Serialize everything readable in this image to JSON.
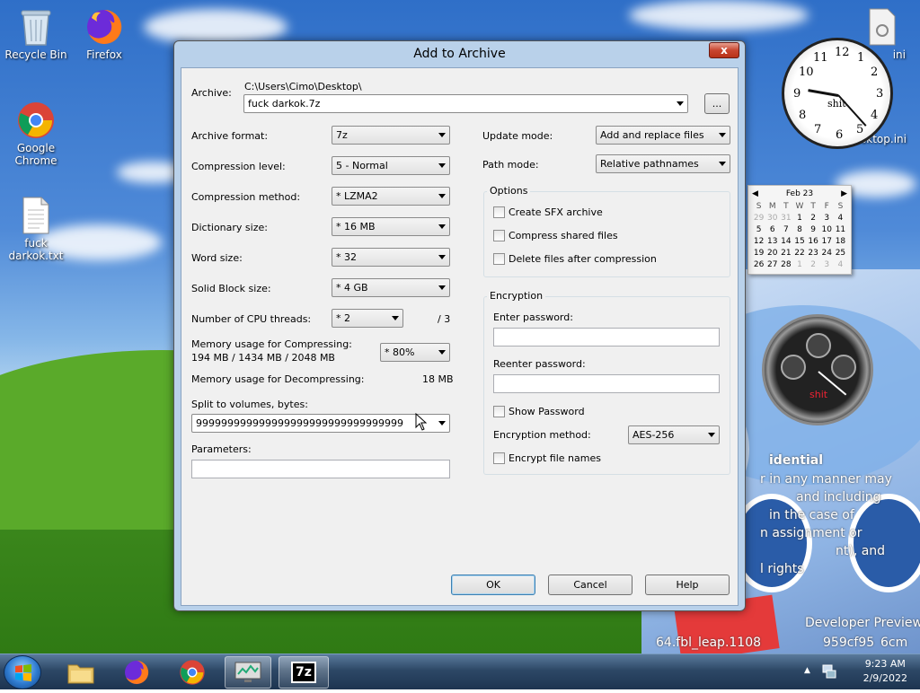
{
  "desktop": {
    "icons": [
      {
        "label": "Recycle Bin"
      },
      {
        "label": "Firefox"
      },
      {
        "label": "Google Chrome"
      },
      {
        "label": "fuck darkok.txt"
      }
    ],
    "right_icons": [
      {
        "label": "desktop.ini"
      },
      {
        "label": "ini"
      }
    ],
    "clock_gadget": {
      "brand": "shit",
      "numbers": [
        "12",
        "1",
        "2",
        "3",
        "4",
        "5",
        "6",
        "7",
        "8",
        "9",
        "10",
        "11"
      ]
    },
    "stopwatch_gadget": {
      "brand": "shit"
    },
    "calendar": {
      "month": "Feb 23",
      "weekdays": [
        "S",
        "M",
        "T",
        "W",
        "T",
        "F",
        "S"
      ],
      "weeks": [
        [
          "29",
          "30",
          "31",
          "1",
          "2",
          "3",
          "4"
        ],
        [
          "5",
          "6",
          "7",
          "8",
          "9",
          "10",
          "11"
        ],
        [
          "12",
          "13",
          "14",
          "15",
          "16",
          "17",
          "18"
        ],
        [
          "19",
          "20",
          "21",
          "22",
          "23",
          "24",
          "25"
        ],
        [
          "26",
          "27",
          "28",
          "1",
          "2",
          "3",
          "4"
        ]
      ]
    },
    "overlay_text": [
      "idential",
      "r in any manner may",
      "and including",
      "in the case of",
      "n assignment or",
      "nt), and",
      "l rights",
      "Developer Preview",
      "64.fbl_leap.1108",
      "959cf95",
      "6cm"
    ]
  },
  "dialog": {
    "title": "Add to Archive",
    "close_label": "x",
    "archive_label": "Archive:",
    "archive_path": "C:\\Users\\Cimo\\Desktop\\",
    "archive_name": "fuck darkok.7z",
    "browse_label": "...",
    "archive_format_label": "Archive format:",
    "archive_format": "7z",
    "compression_level_label": "Compression level:",
    "compression_level": "5 - Normal",
    "compression_method_label": "Compression method:",
    "compression_method": "* LZMA2",
    "dictionary_size_label": "Dictionary size:",
    "dictionary_size": "* 16 MB",
    "word_size_label": "Word size:",
    "word_size": "* 32",
    "solid_block_label": "Solid Block size:",
    "solid_block": "* 4 GB",
    "cpu_threads_label": "Number of CPU threads:",
    "cpu_threads": "* 2",
    "cpu_threads_max": "/ 3",
    "mem_compress_label": "Memory usage for Compressing:",
    "mem_compress_value": "194 MB / 1434 MB / 2048 MB",
    "mem_percent": "* 80%",
    "mem_decompress_label": "Memory usage for Decompressing:",
    "mem_decompress_value": "18 MB",
    "split_label": "Split to volumes, bytes:",
    "split_value": "999999999999999999999999999999999",
    "parameters_label": "Parameters:",
    "parameters_value": "",
    "update_mode_label": "Update mode:",
    "update_mode": "Add and replace files",
    "path_mode_label": "Path mode:",
    "path_mode": "Relative pathnames",
    "options_title": "Options",
    "opt_sfx": "Create SFX archive",
    "opt_shared": "Compress shared files",
    "opt_delete": "Delete files after compression",
    "encryption_title": "Encryption",
    "enter_password_label": "Enter password:",
    "reenter_password_label": "Reenter password:",
    "show_password": "Show Password",
    "encryption_method_label": "Encryption method:",
    "encryption_method": "AES-256",
    "encrypt_names": "Encrypt file names",
    "ok_label": "OK",
    "cancel_label": "Cancel",
    "help_label": "Help"
  },
  "taskbar": {
    "time": "9:23 AM",
    "date": "2/9/2022",
    "zip_label": "7z"
  }
}
